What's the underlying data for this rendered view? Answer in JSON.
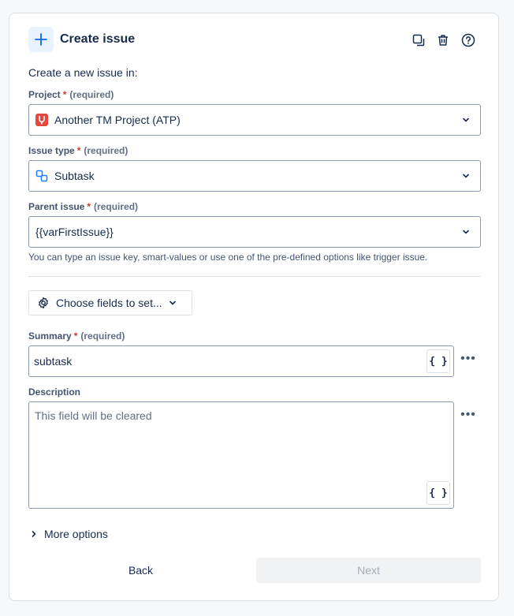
{
  "header": {
    "title": "Create issue",
    "icons": [
      "plus-icon",
      "duplicate-icon",
      "trash-icon",
      "help-icon"
    ]
  },
  "intro": "Create a new issue in:",
  "required_star": "*",
  "required_text": "(required)",
  "project": {
    "label": "Project",
    "value": "Another TM Project (ATP)",
    "icon": "project-avatar-icon"
  },
  "issue_type": {
    "label": "Issue type",
    "value": "Subtask",
    "icon": "subtask-icon"
  },
  "parent_issue": {
    "label": "Parent issue",
    "value": "{{varFirstIssue}}",
    "helper": "You can type an issue key, smart-values or use one of the pre-defined options like trigger issue."
  },
  "choose_fields": {
    "label": "Choose fields to set..."
  },
  "summary": {
    "label": "Summary",
    "value": "subtask"
  },
  "description": {
    "label": "Description",
    "placeholder": "This field will be cleared"
  },
  "smart_value_button": "{ }",
  "more_options": "More options",
  "footer": {
    "back": "Back",
    "next": "Next"
  },
  "colors": {
    "accent": "#0c66e4",
    "danger": "#c9372c",
    "project_icon": "#e2483d"
  }
}
